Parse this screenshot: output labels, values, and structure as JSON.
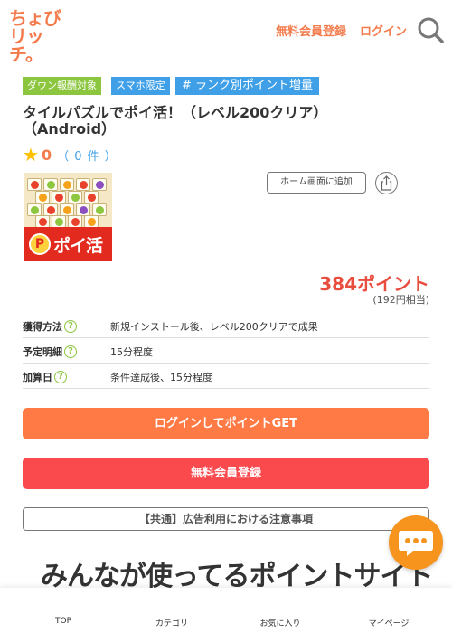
{
  "header": {
    "logo_line1": "ちょび",
    "logo_line2": "リッチ。",
    "register_label": "無料会員登録",
    "login_label": "ログイン",
    "search_icon": "search-icon"
  },
  "badges": [
    "ダウン報酬対象",
    "スマホ限定",
    "# ランク別ポイント増量"
  ],
  "offer": {
    "title_line1": "タイルパズルでポイ活！（レベル200クリア）",
    "title_line2": "（Android）",
    "rating_score": "0",
    "rating_count": "（ 0 件 ）",
    "app_banner_text": "ポイ活",
    "app_coin_label": "P",
    "home_add_label": "ホーム画面に追加",
    "points": "384ポイント",
    "points_yen": "(192円相当)"
  },
  "info": [
    {
      "label": "獲得方法",
      "value": "新規インストール後、レベル200クリアで成果"
    },
    {
      "label": "予定明細",
      "value": "15分程度"
    },
    {
      "label": "加算日",
      "value": "条件達成後、15分程度"
    }
  ],
  "help_mark": "?",
  "buttons": {
    "login_get": "ログインしてポイントGET",
    "register": "無料会員登録",
    "notice": "【共通】広告利用における注意事項"
  },
  "tagline": "みんなが使ってるポイントサイト",
  "bottom_nav": [
    "TOP",
    "カテゴリ",
    "お気に入り",
    "マイページ"
  ],
  "colors": {
    "brand": "#f37b4c",
    "login_button": "#ff7a45",
    "register_button": "#fb4a4e",
    "points": "#e84d3d",
    "badge_green": "#8cc63f",
    "badge_blue": "#3fa0e8",
    "chat_fab": "#f7941d"
  }
}
